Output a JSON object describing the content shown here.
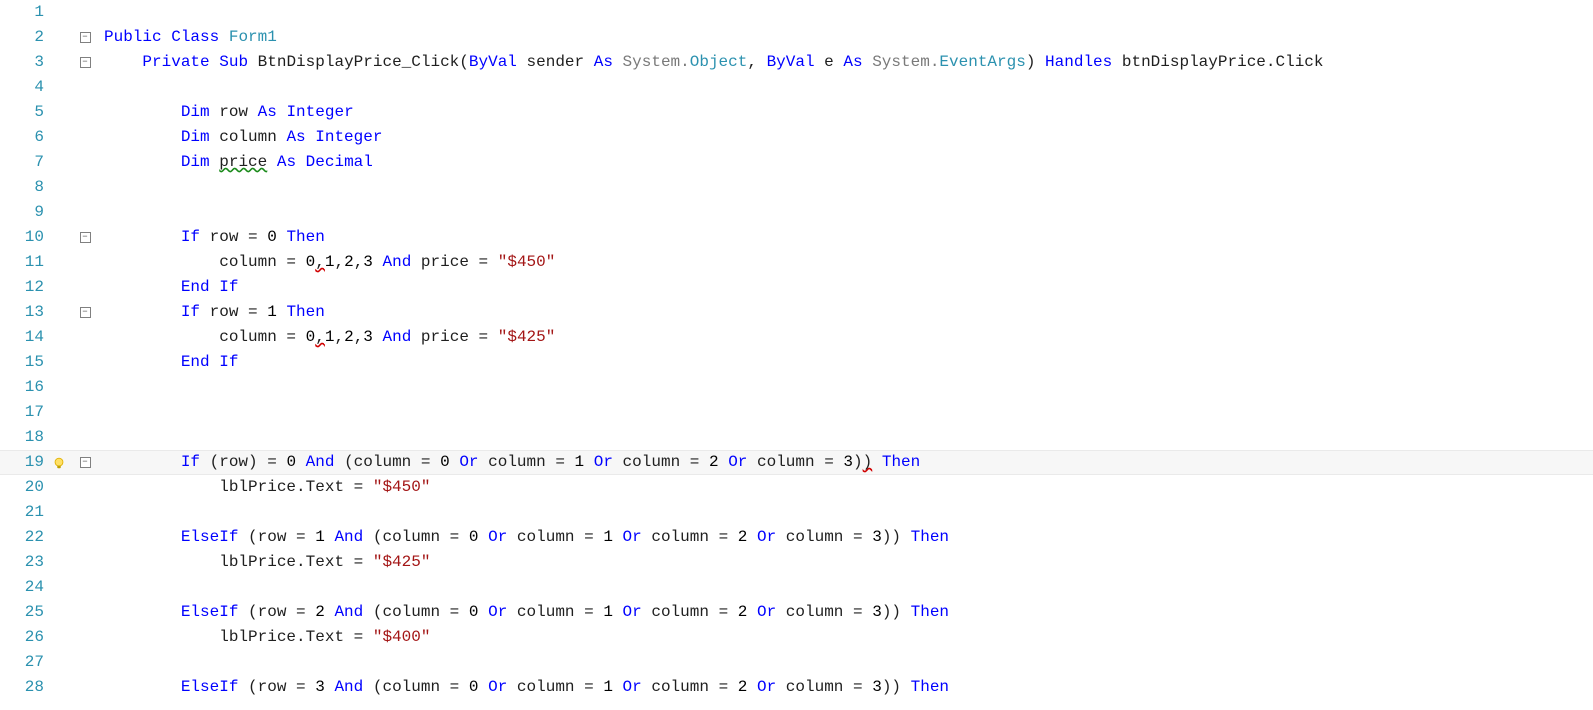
{
  "editor": {
    "language": "VB.NET",
    "currentLine": 19,
    "lines": [
      {
        "n": 1,
        "indent": 0,
        "mod": false,
        "fold": "none",
        "tokens": []
      },
      {
        "n": 2,
        "indent": 0,
        "mod": false,
        "fold": "minus",
        "tokens": [
          [
            "kw",
            "Public"
          ],
          [
            "txt",
            " "
          ],
          [
            "kw",
            "Class"
          ],
          [
            "txt",
            " "
          ],
          [
            "type",
            "Form1"
          ]
        ]
      },
      {
        "n": 3,
        "indent": 1,
        "mod": false,
        "fold": "minus",
        "tokens": [
          [
            "kw",
            "Private"
          ],
          [
            "txt",
            " "
          ],
          [
            "kw",
            "Sub"
          ],
          [
            "txt",
            " BtnDisplayPrice_Click("
          ],
          [
            "kw",
            "ByVal"
          ],
          [
            "txt",
            " sender "
          ],
          [
            "kw",
            "As"
          ],
          [
            "txt",
            " "
          ],
          [
            "param",
            "System."
          ],
          [
            "type",
            "Object"
          ],
          [
            "txt",
            ", "
          ],
          [
            "kw",
            "ByVal"
          ],
          [
            "txt",
            " e "
          ],
          [
            "kw",
            "As"
          ],
          [
            "txt",
            " "
          ],
          [
            "param",
            "System."
          ],
          [
            "type",
            "EventArgs"
          ],
          [
            "txt",
            ") "
          ],
          [
            "kw",
            "Handles"
          ],
          [
            "txt",
            " btnDisplayPrice.Click"
          ]
        ]
      },
      {
        "n": 4,
        "indent": 1,
        "mod": false,
        "fold": "line",
        "tokens": []
      },
      {
        "n": 5,
        "indent": 2,
        "mod": true,
        "fold": "line",
        "tokens": [
          [
            "kw",
            "Dim"
          ],
          [
            "txt",
            " row "
          ],
          [
            "kw",
            "As"
          ],
          [
            "txt",
            " "
          ],
          [
            "kw",
            "Integer"
          ]
        ]
      },
      {
        "n": 6,
        "indent": 2,
        "mod": true,
        "fold": "line",
        "tokens": [
          [
            "kw",
            "Dim"
          ],
          [
            "txt",
            " column "
          ],
          [
            "kw",
            "As"
          ],
          [
            "txt",
            " "
          ],
          [
            "kw",
            "Integer"
          ]
        ]
      },
      {
        "n": 7,
        "indent": 2,
        "mod": true,
        "fold": "line",
        "tokens": [
          [
            "kw",
            "Dim"
          ],
          [
            "txt",
            " "
          ],
          [
            "squiggle",
            "price"
          ],
          [
            "txt",
            " "
          ],
          [
            "kw",
            "As"
          ],
          [
            "txt",
            " "
          ],
          [
            "kw",
            "Decimal"
          ]
        ]
      },
      {
        "n": 8,
        "indent": 2,
        "mod": true,
        "fold": "line",
        "tokens": []
      },
      {
        "n": 9,
        "indent": 2,
        "mod": false,
        "fold": "line",
        "tokens": []
      },
      {
        "n": 10,
        "indent": 2,
        "mod": true,
        "fold": "minus",
        "tokens": [
          [
            "kw",
            "If"
          ],
          [
            "txt",
            " row = "
          ],
          [
            "num",
            "0"
          ],
          [
            "txt",
            " "
          ],
          [
            "kw",
            "Then"
          ]
        ]
      },
      {
        "n": 11,
        "indent": 3,
        "mod": true,
        "fold": "line",
        "tokens": [
          [
            "txt",
            "column = "
          ],
          [
            "num",
            "0"
          ],
          [
            "squiggle-r",
            ","
          ],
          [
            "num",
            "1"
          ],
          [
            "txt",
            ","
          ],
          [
            "num",
            "2"
          ],
          [
            "txt",
            ","
          ],
          [
            "num",
            "3"
          ],
          [
            "txt",
            " "
          ],
          [
            "kw",
            "And"
          ],
          [
            "txt",
            " price = "
          ],
          [
            "str",
            "\"$450\""
          ]
        ]
      },
      {
        "n": 12,
        "indent": 2,
        "mod": true,
        "fold": "line",
        "tokens": [
          [
            "kw",
            "End"
          ],
          [
            "txt",
            " "
          ],
          [
            "kw",
            "If"
          ]
        ]
      },
      {
        "n": 13,
        "indent": 2,
        "mod": true,
        "fold": "minus",
        "tokens": [
          [
            "kw",
            "If"
          ],
          [
            "txt",
            " row = "
          ],
          [
            "num",
            "1"
          ],
          [
            "txt",
            " "
          ],
          [
            "kw",
            "Then"
          ]
        ]
      },
      {
        "n": 14,
        "indent": 3,
        "mod": true,
        "fold": "line",
        "tokens": [
          [
            "txt",
            "column = "
          ],
          [
            "num",
            "0"
          ],
          [
            "squiggle-r",
            ","
          ],
          [
            "num",
            "1"
          ],
          [
            "txt",
            ","
          ],
          [
            "num",
            "2"
          ],
          [
            "txt",
            ","
          ],
          [
            "num",
            "3"
          ],
          [
            "txt",
            " "
          ],
          [
            "kw",
            "And"
          ],
          [
            "txt",
            " price = "
          ],
          [
            "str",
            "\"$425\""
          ]
        ]
      },
      {
        "n": 15,
        "indent": 2,
        "mod": true,
        "fold": "line",
        "tokens": [
          [
            "kw",
            "End"
          ],
          [
            "txt",
            " "
          ],
          [
            "kw",
            "If"
          ]
        ]
      },
      {
        "n": 16,
        "indent": 2,
        "mod": true,
        "fold": "line",
        "tokens": []
      },
      {
        "n": 17,
        "indent": 2,
        "mod": true,
        "fold": "line",
        "tokens": []
      },
      {
        "n": 18,
        "indent": 2,
        "mod": true,
        "fold": "line",
        "tokens": []
      },
      {
        "n": 19,
        "indent": 2,
        "mod": true,
        "fold": "minus",
        "tokens": [
          [
            "kw",
            "If"
          ],
          [
            "txt",
            " (row) = "
          ],
          [
            "num",
            "0"
          ],
          [
            "txt",
            " "
          ],
          [
            "kw",
            "And"
          ],
          [
            "txt",
            " (column = "
          ],
          [
            "num",
            "0"
          ],
          [
            "txt",
            " "
          ],
          [
            "kw",
            "Or"
          ],
          [
            "txt",
            " column = "
          ],
          [
            "num",
            "1"
          ],
          [
            "txt",
            " "
          ],
          [
            "kw",
            "Or"
          ],
          [
            "txt",
            " column = "
          ],
          [
            "num",
            "2"
          ],
          [
            "txt",
            " "
          ],
          [
            "kw",
            "Or"
          ],
          [
            "txt",
            " column = "
          ],
          [
            "num",
            "3"
          ],
          [
            "txt",
            ")"
          ],
          [
            "squiggle-r",
            ")"
          ],
          [
            "txt",
            " "
          ],
          [
            "kw",
            "Then"
          ]
        ]
      },
      {
        "n": 20,
        "indent": 3,
        "mod": true,
        "fold": "line",
        "tokens": [
          [
            "txt",
            "lblPrice.Text = "
          ],
          [
            "str",
            "\"$450\""
          ]
        ]
      },
      {
        "n": 21,
        "indent": 2,
        "mod": false,
        "fold": "line",
        "tokens": []
      },
      {
        "n": 22,
        "indent": 2,
        "mod": false,
        "fold": "line",
        "tokens": [
          [
            "kw",
            "ElseIf"
          ],
          [
            "txt",
            " (row = "
          ],
          [
            "num",
            "1"
          ],
          [
            "txt",
            " "
          ],
          [
            "kw",
            "And"
          ],
          [
            "txt",
            " (column = "
          ],
          [
            "num",
            "0"
          ],
          [
            "txt",
            " "
          ],
          [
            "kw",
            "Or"
          ],
          [
            "txt",
            " column = "
          ],
          [
            "num",
            "1"
          ],
          [
            "txt",
            " "
          ],
          [
            "kw",
            "Or"
          ],
          [
            "txt",
            " column = "
          ],
          [
            "num",
            "2"
          ],
          [
            "txt",
            " "
          ],
          [
            "kw",
            "Or"
          ],
          [
            "txt",
            " column = "
          ],
          [
            "num",
            "3"
          ],
          [
            "txt",
            ")) "
          ],
          [
            "kw",
            "Then"
          ]
        ]
      },
      {
        "n": 23,
        "indent": 3,
        "mod": false,
        "fold": "line",
        "tokens": [
          [
            "txt",
            "lblPrice.Text = "
          ],
          [
            "str",
            "\"$425\""
          ]
        ]
      },
      {
        "n": 24,
        "indent": 2,
        "mod": false,
        "fold": "line",
        "tokens": []
      },
      {
        "n": 25,
        "indent": 2,
        "mod": false,
        "fold": "line",
        "tokens": [
          [
            "kw",
            "ElseIf"
          ],
          [
            "txt",
            " (row = "
          ],
          [
            "num",
            "2"
          ],
          [
            "txt",
            " "
          ],
          [
            "kw",
            "And"
          ],
          [
            "txt",
            " (column = "
          ],
          [
            "num",
            "0"
          ],
          [
            "txt",
            " "
          ],
          [
            "kw",
            "Or"
          ],
          [
            "txt",
            " column = "
          ],
          [
            "num",
            "1"
          ],
          [
            "txt",
            " "
          ],
          [
            "kw",
            "Or"
          ],
          [
            "txt",
            " column = "
          ],
          [
            "num",
            "2"
          ],
          [
            "txt",
            " "
          ],
          [
            "kw",
            "Or"
          ],
          [
            "txt",
            " column = "
          ],
          [
            "num",
            "3"
          ],
          [
            "txt",
            ")) "
          ],
          [
            "kw",
            "Then"
          ]
        ]
      },
      {
        "n": 26,
        "indent": 3,
        "mod": false,
        "fold": "line",
        "tokens": [
          [
            "txt",
            "lblPrice.Text = "
          ],
          [
            "str",
            "\"$400\""
          ]
        ]
      },
      {
        "n": 27,
        "indent": 2,
        "mod": false,
        "fold": "line",
        "tokens": []
      },
      {
        "n": 28,
        "indent": 2,
        "mod": false,
        "fold": "line",
        "tokens": [
          [
            "kw",
            "ElseIf"
          ],
          [
            "txt",
            " (row = "
          ],
          [
            "num",
            "3"
          ],
          [
            "txt",
            " "
          ],
          [
            "kw",
            "And"
          ],
          [
            "txt",
            " (column = "
          ],
          [
            "num",
            "0"
          ],
          [
            "txt",
            " "
          ],
          [
            "kw",
            "Or"
          ],
          [
            "txt",
            " column = "
          ],
          [
            "num",
            "1"
          ],
          [
            "txt",
            " "
          ],
          [
            "kw",
            "Or"
          ],
          [
            "txt",
            " column = "
          ],
          [
            "num",
            "2"
          ],
          [
            "txt",
            " "
          ],
          [
            "kw",
            "Or"
          ],
          [
            "txt",
            " column = "
          ],
          [
            "num",
            "3"
          ],
          [
            "txt",
            ")) "
          ],
          [
            "kw",
            "Then"
          ]
        ]
      }
    ]
  },
  "icons": {
    "bulb_tooltip": "Quick Actions",
    "fold_collapse": "−",
    "fold_expand": "+"
  }
}
